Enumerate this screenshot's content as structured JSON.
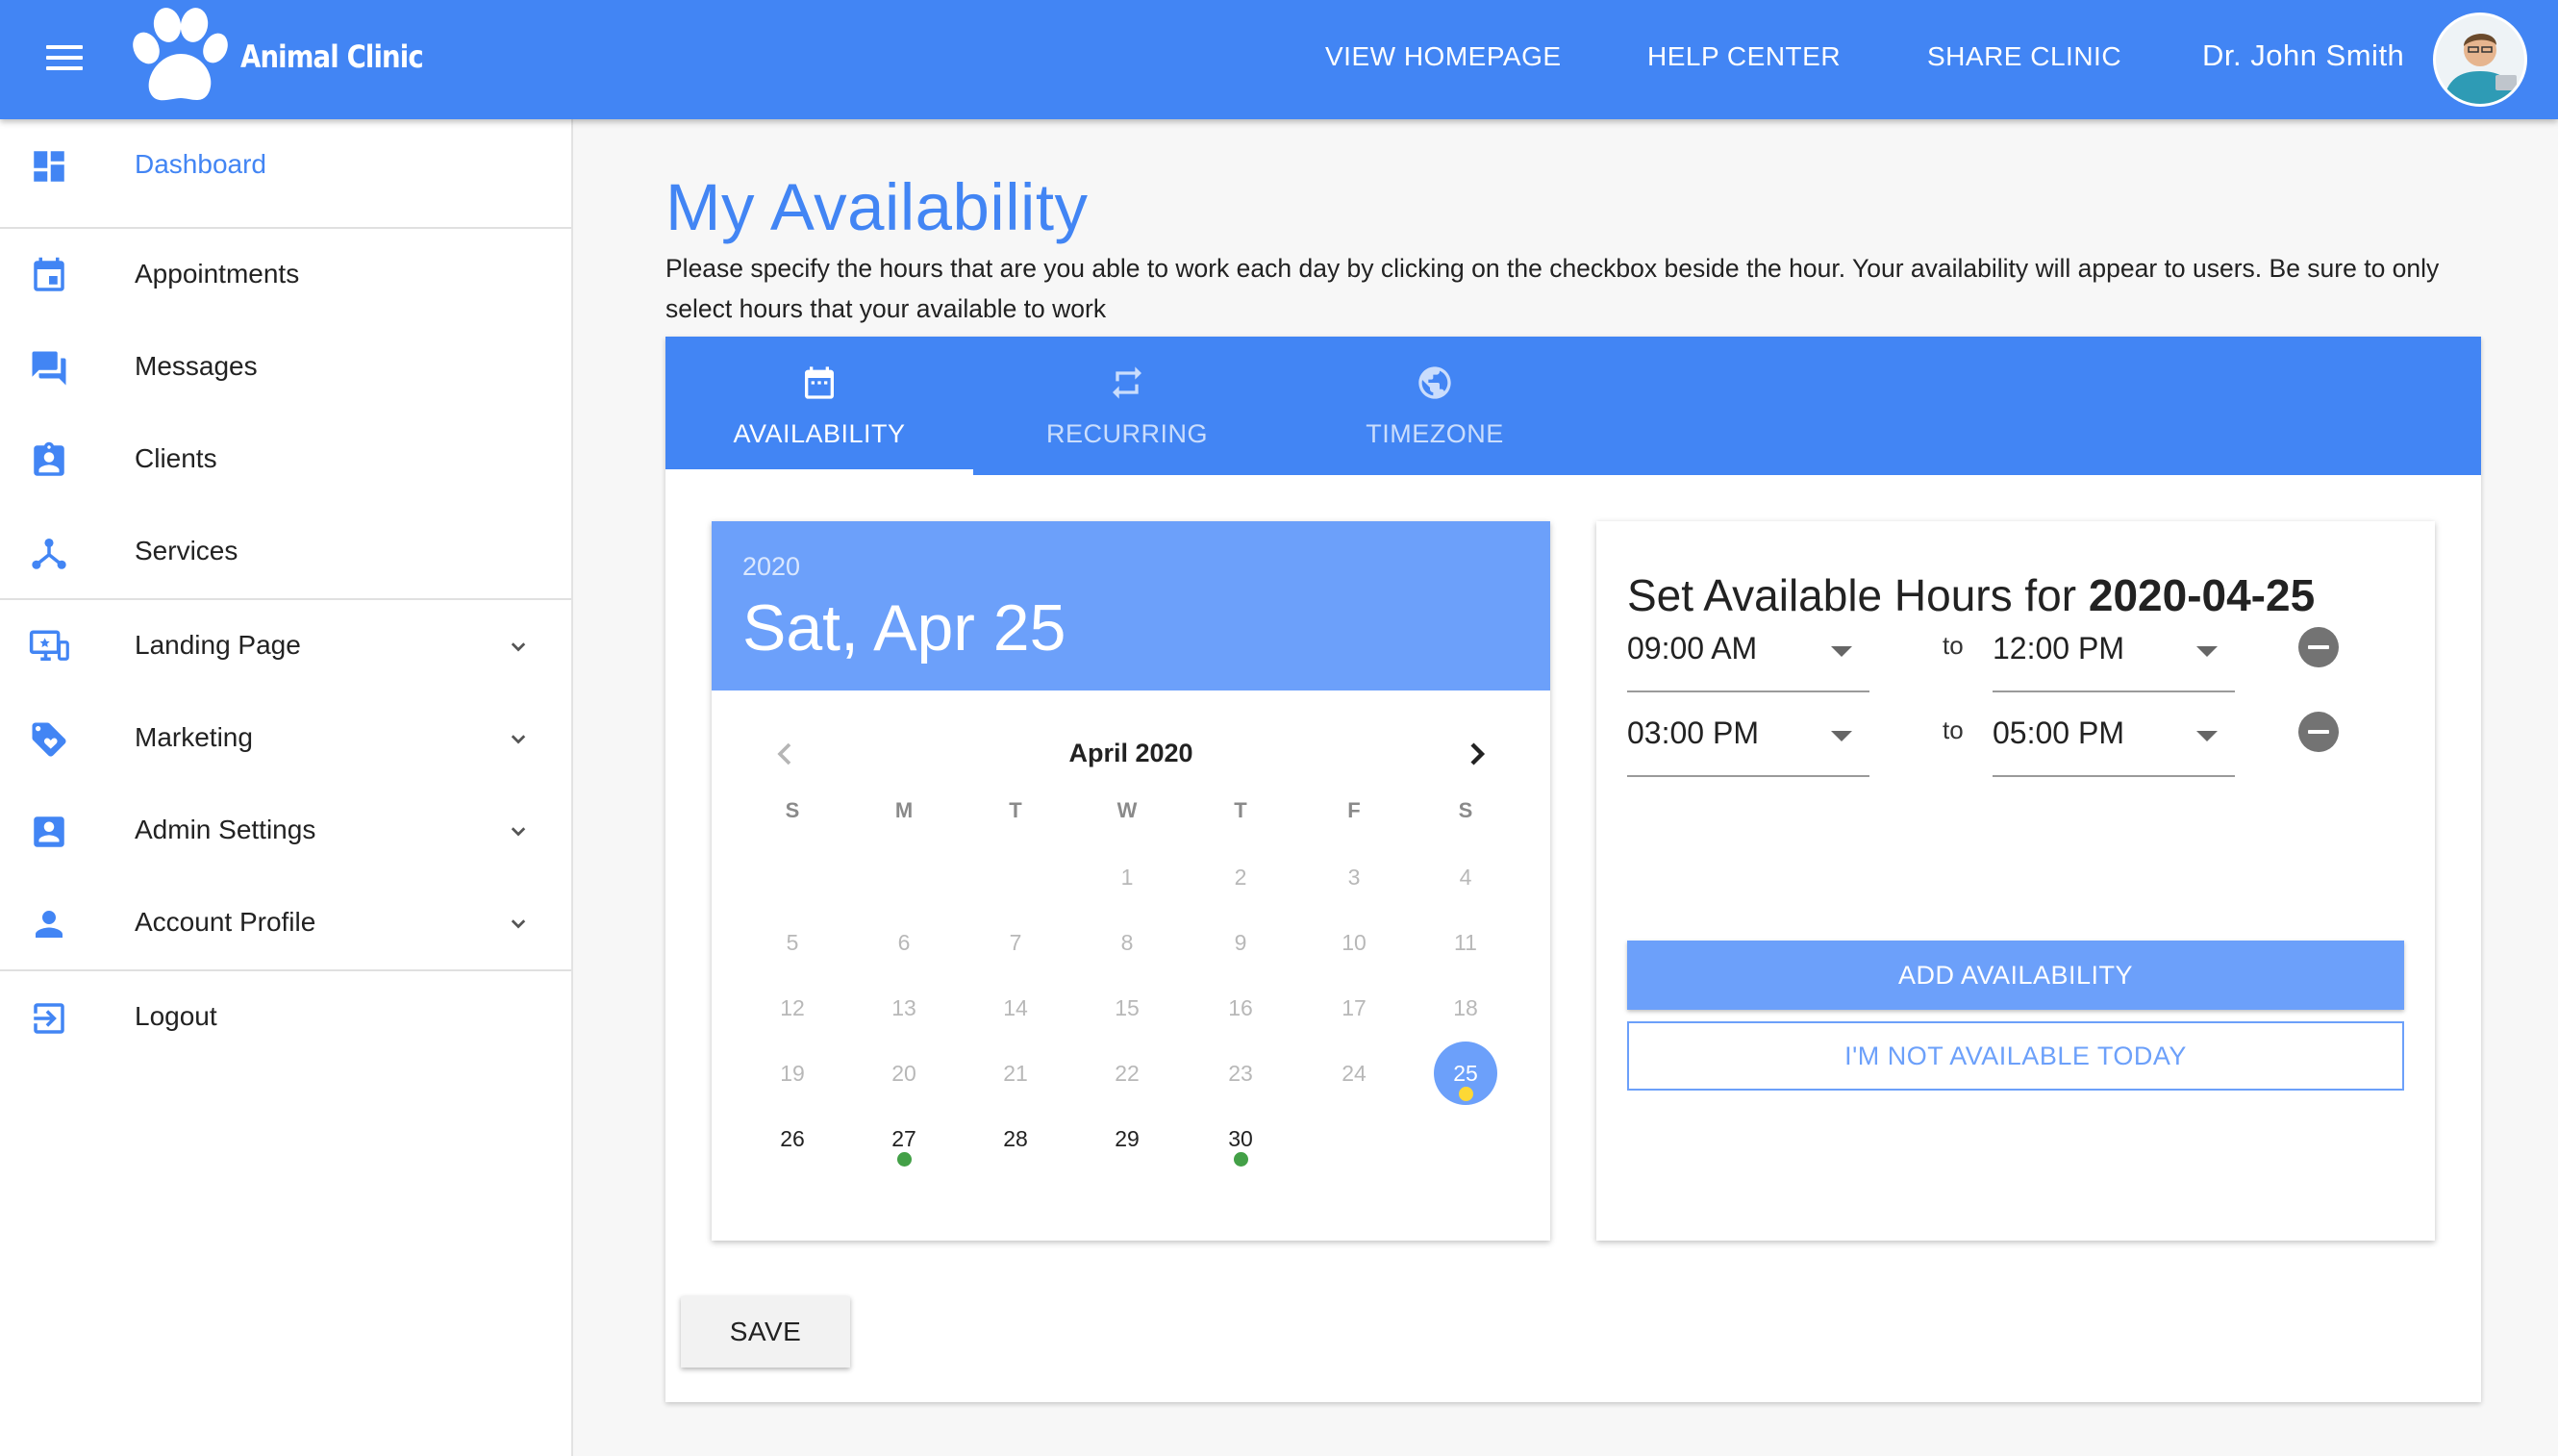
{
  "header": {
    "brand": "Animal Clinic",
    "nav": [
      "VIEW HOMEPAGE",
      "HELP CENTER",
      "SHARE CLINIC"
    ],
    "user_name": "Dr. John Smith"
  },
  "sidebar": {
    "items": [
      {
        "label": "Dashboard",
        "icon": "dashboard-icon"
      },
      {
        "label": "Appointments",
        "icon": "calendar-icon"
      },
      {
        "label": "Messages",
        "icon": "chat-icon"
      },
      {
        "label": "Clients",
        "icon": "badge-icon"
      },
      {
        "label": "Services",
        "icon": "hub-icon"
      },
      {
        "label": "Landing Page",
        "icon": "monitor-icon"
      },
      {
        "label": "Marketing",
        "icon": "tag-heart-icon"
      },
      {
        "label": "Admin Settings",
        "icon": "account-box-icon"
      },
      {
        "label": "Account Profile",
        "icon": "person-icon"
      },
      {
        "label": "Logout",
        "icon": "logout-icon"
      }
    ]
  },
  "page": {
    "title": "My Availability",
    "description": "Please specify the hours that are you able to work each day by clicking on the checkbox beside the hour. Your availability will appear to users. Be sure to only select hours that your available to work"
  },
  "tabs": [
    "AVAILABILITY",
    "RECURRING",
    "TIMEZONE"
  ],
  "calendar": {
    "year": "2020",
    "selected_label": "Sat, Apr 25",
    "month_label": "April 2020",
    "weekdays": [
      "S",
      "M",
      "T",
      "W",
      "T",
      "F",
      "S"
    ],
    "days": [
      "1",
      "2",
      "3",
      "4",
      "5",
      "6",
      "7",
      "8",
      "9",
      "10",
      "11",
      "12",
      "13",
      "14",
      "15",
      "16",
      "17",
      "18",
      "19",
      "20",
      "21",
      "22",
      "23",
      "24",
      "25",
      "26",
      "27",
      "28",
      "29",
      "30"
    ],
    "first_weekday": 3,
    "selected_day": 25,
    "first_available_day": 26,
    "event_days": [
      27,
      30,
      25
    ],
    "colors": {
      "accent": "#6ca0fa",
      "event_dot": "#43a047",
      "today_dot": "#fdd835"
    }
  },
  "hours": {
    "title_prefix": "Set Available Hours for",
    "date": "2020-04-25",
    "ranges": [
      {
        "from": "09:00 AM",
        "to": "12:00 PM"
      },
      {
        "from": "03:00 PM",
        "to": "05:00 PM"
      }
    ],
    "to_label": "to",
    "add_label": "ADD AVAILABILITY",
    "unavailable_label": "I'M NOT AVAILABLE TODAY"
  },
  "save_label": "SAVE",
  "colors": {
    "primary": "#4285f4"
  }
}
